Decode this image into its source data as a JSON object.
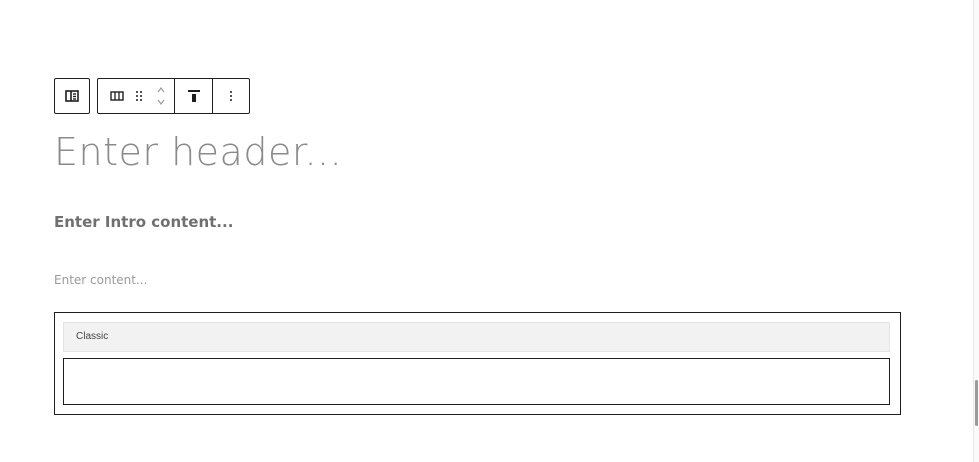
{
  "toolbar": {
    "parent_icon": "select-parent-icon",
    "columns_icon": "columns-icon",
    "drag_icon": "drag-handle-icon",
    "mover_icon": "move-up-down-icon",
    "align_icon": "align-top-icon",
    "more_icon": "more-options-icon"
  },
  "content": {
    "header": "Enter header...",
    "intro": "Enter Intro content...",
    "body": "Enter content..."
  },
  "classic": {
    "label": "Classic",
    "editor_value": ""
  }
}
